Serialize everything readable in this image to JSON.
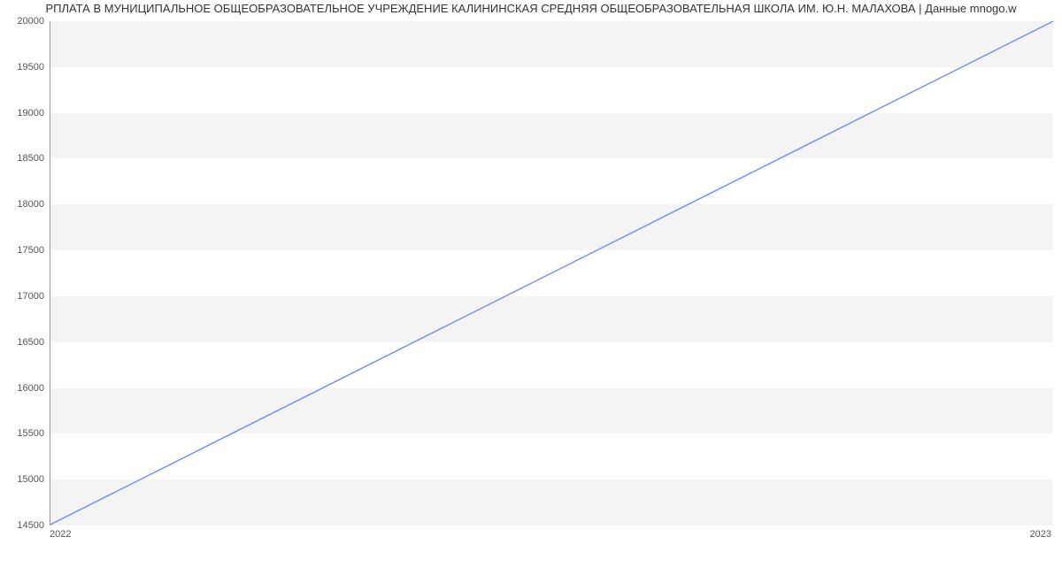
{
  "chart_data": {
    "type": "line",
    "title": "РПЛАТА В МУНИЦИПАЛЬНОЕ ОБЩЕОБРАЗОВАТЕЛЬНОЕ УЧРЕЖДЕНИЕ  КАЛИНИНСКАЯ СРЕДНЯЯ ОБЩЕОБРАЗОВАТЕЛЬНАЯ ШКОЛА ИМ. Ю.Н. МАЛАХОВА | Данные mnogo.w",
    "x": [
      "2022",
      "2023"
    ],
    "values": [
      14500,
      20000
    ],
    "yticks": [
      14500,
      15000,
      15500,
      16000,
      16500,
      17000,
      17500,
      18000,
      18500,
      19000,
      19500,
      20000
    ],
    "ylim": [
      14500,
      20000
    ],
    "line_color": "#6b8ef2",
    "xlabel": "",
    "ylabel": ""
  }
}
